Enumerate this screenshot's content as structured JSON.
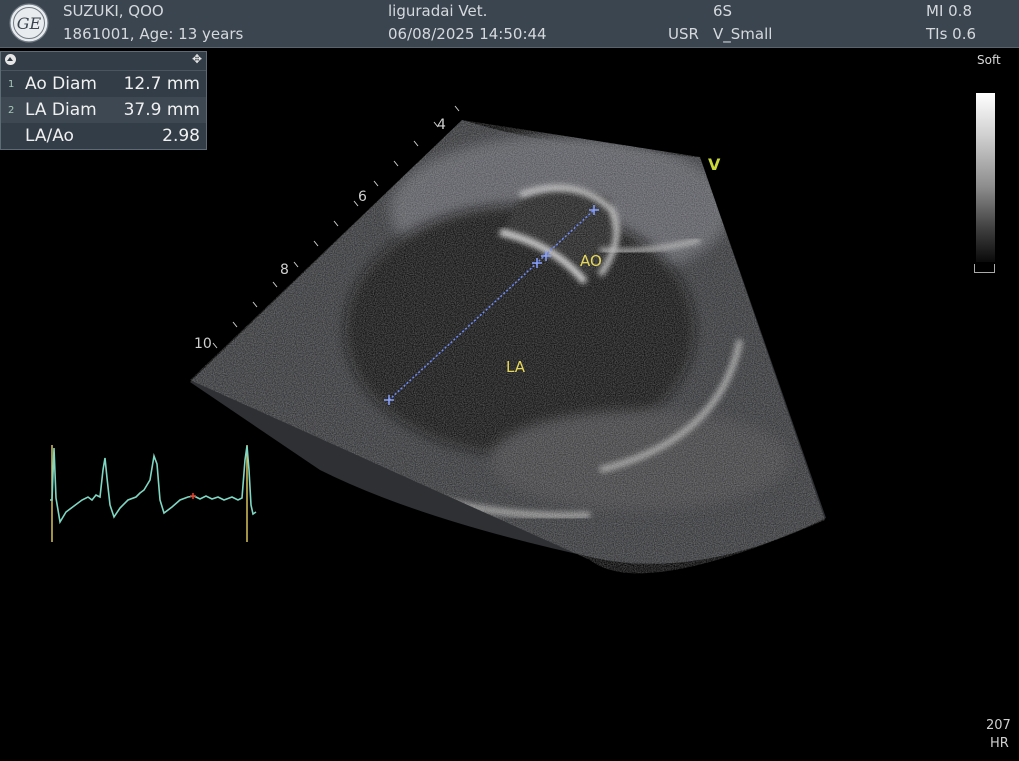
{
  "header": {
    "patient_name": "SUZUKI, QOO",
    "patient_info": "1861001, Age: 13 years",
    "institution": "liguradai Vet.",
    "datetime": "06/08/2025 14:50:44",
    "user_tag": "USR",
    "probe": "6S",
    "preset": "V_Small",
    "mi": "MI 0.8",
    "tis": "TIs 0.6"
  },
  "measurements": [
    {
      "index": "1",
      "label": "Ao Diam",
      "value": "12.7 mm"
    },
    {
      "index": "2",
      "label": "LA Diam",
      "value": "37.9 mm"
    },
    {
      "index": "",
      "label": "LA/Ao",
      "value": "2.98"
    }
  ],
  "grayscale_map": "Soft",
  "depth_marks": [
    "4",
    "6",
    "8",
    "10"
  ],
  "anatomy_labels": {
    "ao": "AO",
    "la": "LA",
    "orientation": "V"
  },
  "heart_rate": {
    "value": "207",
    "label": "HR"
  },
  "icons": {
    "logo": "ge-logo",
    "collapse": "collapse-arrow-icon",
    "move": "move-crosshair-icon"
  },
  "colors": {
    "caliper": "#6f8cff",
    "ecg": "#7fd6c2",
    "anatomy_label": "#e8d85a",
    "header_bg": "#3a4550"
  }
}
